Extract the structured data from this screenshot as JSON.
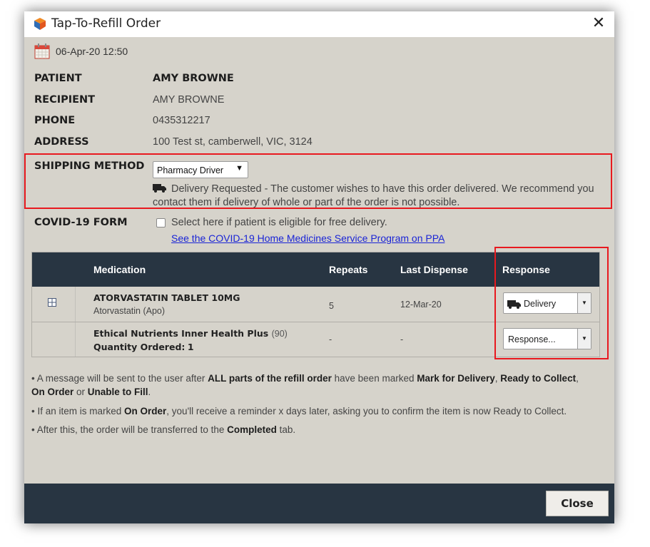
{
  "window": {
    "title": "Tap-To-Refill Order",
    "icons": {
      "app": "app-logo-icon",
      "close": "close-icon"
    }
  },
  "order": {
    "date": "06-Apr-20 12:50",
    "date_icon": "calendar-icon",
    "fields": {
      "patient_label": "PATIENT",
      "patient_value": "AMY BROWNE",
      "recipient_label": "RECIPIENT",
      "recipient_value": "AMY BROWNE",
      "phone_label": "PHONE",
      "phone_value": "0435312217",
      "address_label": "ADDRESS",
      "address_value": "100 Test st, camberwell, VIC, 3124"
    }
  },
  "shipping": {
    "label": "SHIPPING METHOD",
    "selected": "Pharmacy Driver",
    "note": "Delivery Requested - The customer wishes to have this order delivered. We recommend you contact them if delivery of whole or part of the order is not possible.",
    "note_icon": "truck-icon"
  },
  "covid": {
    "label": "COVID-19 FORM",
    "checkbox_label": "Select here if patient is eligible for free delivery.",
    "checked": false,
    "link_text": "See the COVID-19 Home Medicines Service Program on PPA"
  },
  "table": {
    "headers": {
      "medication": "Medication",
      "repeats": "Repeats",
      "last_dispense": "Last Dispense",
      "response": "Response"
    },
    "rows": [
      {
        "name": "ATORVASTATIN TABLET 10MG",
        "subtitle": "Atorvastatin (Apo)",
        "repeats": "5",
        "last_dispense": "12-Mar-20",
        "response": "Delivery",
        "expand_icon": "expand-plus-icon"
      },
      {
        "name": "Ethical Nutrients Inner Health Plus",
        "name_qty": "(90)",
        "qty_label": "Quantity Ordered:",
        "qty_value": "1",
        "repeats": "-",
        "last_dispense": "-",
        "response": "Response..."
      }
    ]
  },
  "notes": {
    "n1_a": "• A message will be sent to the user after ",
    "n1_b": "ALL parts of the refill order",
    "n1_c": " have been marked ",
    "n1_d": "Mark for Delivery",
    "n1_e": ", ",
    "n1_f": "Ready to Collect",
    "n1_g": ",",
    "n1_h": "On Order",
    "n1_i": " or ",
    "n1_j": "Unable to Fill",
    "n1_k": ".",
    "n2_a": "• If an item is marked ",
    "n2_b": "On Order",
    "n2_c": ", you'll receive a reminder x days later, asking you to confirm the item is now Ready to Collect.",
    "n3_a": "• After this, the order will be transferred to the ",
    "n3_b": "Completed",
    "n3_c": " tab."
  },
  "footer": {
    "close_label": "Close"
  },
  "colors": {
    "dialog_bg": "#d6d3cb",
    "header_bg": "#283542",
    "highlight": "#e8191f",
    "link": "#1a24d6"
  }
}
